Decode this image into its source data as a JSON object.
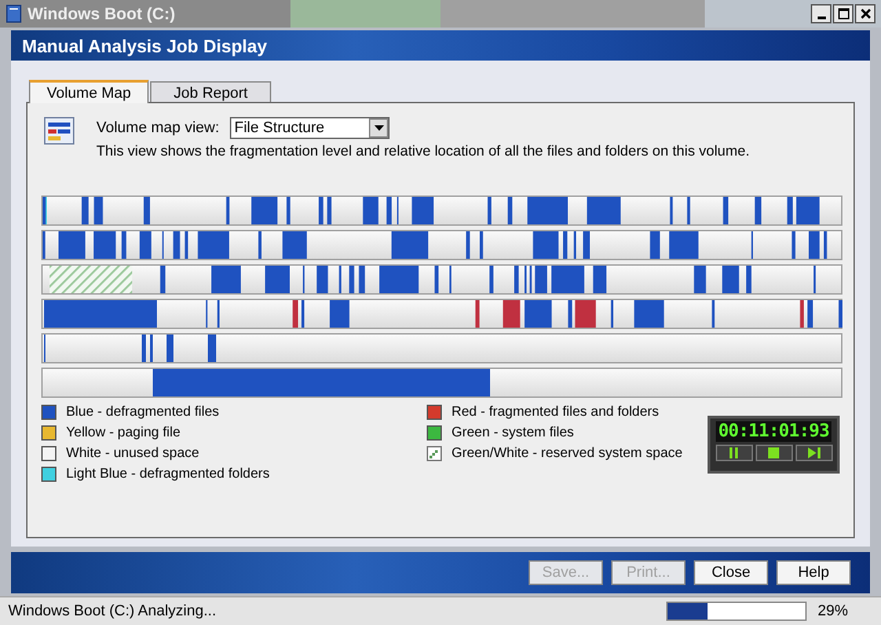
{
  "window": {
    "title": "Windows Boot (C:)"
  },
  "header": {
    "title": "Manual Analysis Job Display"
  },
  "tabs": [
    {
      "label": "Volume Map",
      "selected": true
    },
    {
      "label": "Job Report",
      "selected": false
    }
  ],
  "view": {
    "label": "Volume map view:",
    "value": "File Structure",
    "description": "This view shows the fragmentation level and relative location of all the files and folders on this volume."
  },
  "legend": [
    {
      "label": "Blue - defragmented files",
      "color": "#1f52c0",
      "kind": "solid"
    },
    {
      "label": "Red - fragmented files and folders",
      "color": "#d43a2c",
      "kind": "solid"
    },
    {
      "label": "Yellow - paging file",
      "color": "#e8b830",
      "kind": "solid"
    },
    {
      "label": "Green - system files",
      "color": "#3cb840",
      "kind": "solid"
    },
    {
      "label": "White - unused space",
      "color": "#f4f4f4",
      "kind": "solid"
    },
    {
      "label": "Green/White - reserved system space",
      "color": "#5a9a5a",
      "kind": "hatch"
    },
    {
      "label": "Light Blue - defragmented folders",
      "color": "#40d0e0",
      "kind": "solid"
    }
  ],
  "timer": {
    "time": "00:11:01:93"
  },
  "buttons": [
    {
      "label": "Save...",
      "disabled": true
    },
    {
      "label": "Print...",
      "disabled": true
    },
    {
      "label": "Close",
      "disabled": false
    },
    {
      "label": "Help",
      "disabled": false
    }
  ],
  "status_bar": {
    "text": "Windows Boot (C:) Analyzing...",
    "level": 0.29,
    "reading": "29%"
  }
}
